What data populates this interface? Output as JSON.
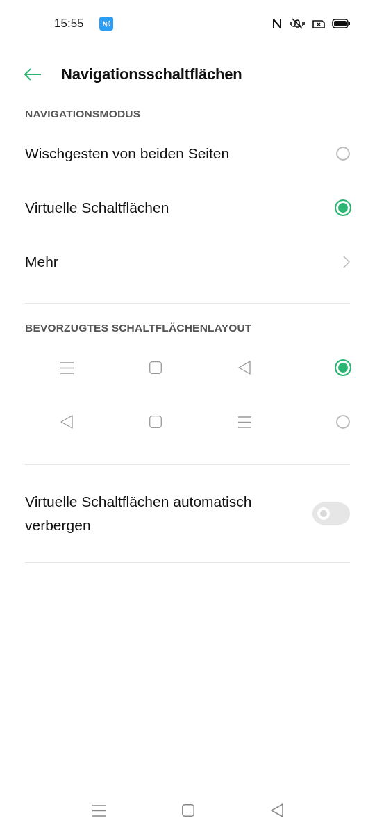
{
  "status_bar": {
    "time": "15:55"
  },
  "header": {
    "title": "Navigationsschaltflächen"
  },
  "mode_section": {
    "heading": "NAVIGATIONSMODUS",
    "items": [
      {
        "label": "Wischgesten von beiden Seiten",
        "kind": "radio",
        "selected": false
      },
      {
        "label": "Virtuelle Schaltflächen",
        "kind": "radio",
        "selected": true
      },
      {
        "label": "Mehr",
        "kind": "link"
      }
    ]
  },
  "layout_section": {
    "heading": "BEVORZUGTES SCHALTFLÄCHENLAYOUT",
    "layouts": [
      {
        "buttons": [
          {
            "kind": "menu"
          },
          {
            "kind": "home"
          },
          {
            "kind": "back"
          }
        ],
        "selected": true
      },
      {
        "buttons": [
          {
            "kind": "back"
          },
          {
            "kind": "home"
          },
          {
            "kind": "menu"
          }
        ],
        "selected": false
      }
    ]
  },
  "auto_hide": {
    "label": "Virtuelle Schaltflächen automatisch verbergen",
    "on": false
  },
  "nav_bar": {
    "buttons": [
      {
        "kind": "menu"
      },
      {
        "kind": "home"
      },
      {
        "kind": "back"
      }
    ]
  }
}
